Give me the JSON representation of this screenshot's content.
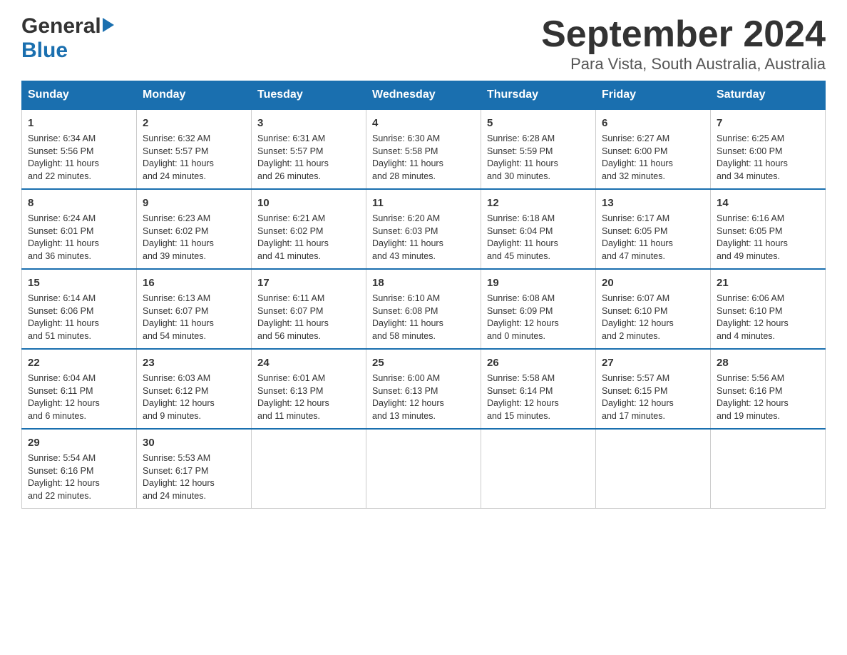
{
  "header": {
    "logo_general": "General",
    "logo_blue": "Blue",
    "month_year": "September 2024",
    "location": "Para Vista, South Australia, Australia"
  },
  "days_of_week": [
    "Sunday",
    "Monday",
    "Tuesday",
    "Wednesday",
    "Thursday",
    "Friday",
    "Saturday"
  ],
  "weeks": [
    [
      {
        "day": 1,
        "sunrise": "6:34 AM",
        "sunset": "5:56 PM",
        "daylight": "11 hours and 22 minutes."
      },
      {
        "day": 2,
        "sunrise": "6:32 AM",
        "sunset": "5:57 PM",
        "daylight": "11 hours and 24 minutes."
      },
      {
        "day": 3,
        "sunrise": "6:31 AM",
        "sunset": "5:57 PM",
        "daylight": "11 hours and 26 minutes."
      },
      {
        "day": 4,
        "sunrise": "6:30 AM",
        "sunset": "5:58 PM",
        "daylight": "11 hours and 28 minutes."
      },
      {
        "day": 5,
        "sunrise": "6:28 AM",
        "sunset": "5:59 PM",
        "daylight": "11 hours and 30 minutes."
      },
      {
        "day": 6,
        "sunrise": "6:27 AM",
        "sunset": "6:00 PM",
        "daylight": "11 hours and 32 minutes."
      },
      {
        "day": 7,
        "sunrise": "6:25 AM",
        "sunset": "6:00 PM",
        "daylight": "11 hours and 34 minutes."
      }
    ],
    [
      {
        "day": 8,
        "sunrise": "6:24 AM",
        "sunset": "6:01 PM",
        "daylight": "11 hours and 36 minutes."
      },
      {
        "day": 9,
        "sunrise": "6:23 AM",
        "sunset": "6:02 PM",
        "daylight": "11 hours and 39 minutes."
      },
      {
        "day": 10,
        "sunrise": "6:21 AM",
        "sunset": "6:02 PM",
        "daylight": "11 hours and 41 minutes."
      },
      {
        "day": 11,
        "sunrise": "6:20 AM",
        "sunset": "6:03 PM",
        "daylight": "11 hours and 43 minutes."
      },
      {
        "day": 12,
        "sunrise": "6:18 AM",
        "sunset": "6:04 PM",
        "daylight": "11 hours and 45 minutes."
      },
      {
        "day": 13,
        "sunrise": "6:17 AM",
        "sunset": "6:05 PM",
        "daylight": "11 hours and 47 minutes."
      },
      {
        "day": 14,
        "sunrise": "6:16 AM",
        "sunset": "6:05 PM",
        "daylight": "11 hours and 49 minutes."
      }
    ],
    [
      {
        "day": 15,
        "sunrise": "6:14 AM",
        "sunset": "6:06 PM",
        "daylight": "11 hours and 51 minutes."
      },
      {
        "day": 16,
        "sunrise": "6:13 AM",
        "sunset": "6:07 PM",
        "daylight": "11 hours and 54 minutes."
      },
      {
        "day": 17,
        "sunrise": "6:11 AM",
        "sunset": "6:07 PM",
        "daylight": "11 hours and 56 minutes."
      },
      {
        "day": 18,
        "sunrise": "6:10 AM",
        "sunset": "6:08 PM",
        "daylight": "11 hours and 58 minutes."
      },
      {
        "day": 19,
        "sunrise": "6:08 AM",
        "sunset": "6:09 PM",
        "daylight": "12 hours and 0 minutes."
      },
      {
        "day": 20,
        "sunrise": "6:07 AM",
        "sunset": "6:10 PM",
        "daylight": "12 hours and 2 minutes."
      },
      {
        "day": 21,
        "sunrise": "6:06 AM",
        "sunset": "6:10 PM",
        "daylight": "12 hours and 4 minutes."
      }
    ],
    [
      {
        "day": 22,
        "sunrise": "6:04 AM",
        "sunset": "6:11 PM",
        "daylight": "12 hours and 6 minutes."
      },
      {
        "day": 23,
        "sunrise": "6:03 AM",
        "sunset": "6:12 PM",
        "daylight": "12 hours and 9 minutes."
      },
      {
        "day": 24,
        "sunrise": "6:01 AM",
        "sunset": "6:13 PM",
        "daylight": "12 hours and 11 minutes."
      },
      {
        "day": 25,
        "sunrise": "6:00 AM",
        "sunset": "6:13 PM",
        "daylight": "12 hours and 13 minutes."
      },
      {
        "day": 26,
        "sunrise": "5:58 AM",
        "sunset": "6:14 PM",
        "daylight": "12 hours and 15 minutes."
      },
      {
        "day": 27,
        "sunrise": "5:57 AM",
        "sunset": "6:15 PM",
        "daylight": "12 hours and 17 minutes."
      },
      {
        "day": 28,
        "sunrise": "5:56 AM",
        "sunset": "6:16 PM",
        "daylight": "12 hours and 19 minutes."
      }
    ],
    [
      {
        "day": 29,
        "sunrise": "5:54 AM",
        "sunset": "6:16 PM",
        "daylight": "12 hours and 22 minutes."
      },
      {
        "day": 30,
        "sunrise": "5:53 AM",
        "sunset": "6:17 PM",
        "daylight": "12 hours and 24 minutes."
      },
      null,
      null,
      null,
      null,
      null
    ]
  ],
  "labels": {
    "sunrise_prefix": "Sunrise: ",
    "sunset_prefix": "Sunset: ",
    "daylight_prefix": "Daylight: "
  }
}
